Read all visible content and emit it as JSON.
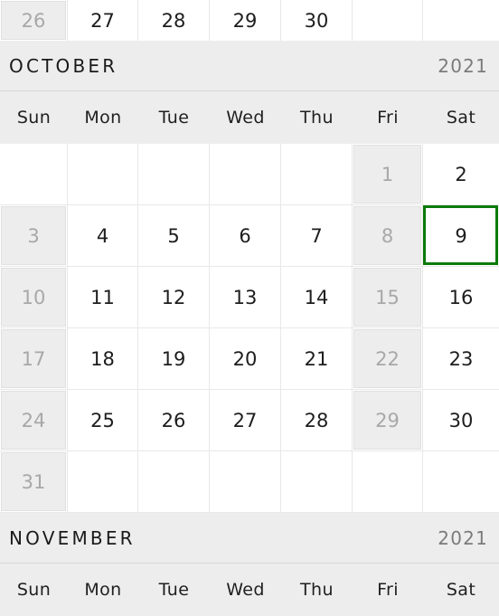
{
  "colors": {
    "selected_border": "#0a7a0a",
    "header_background": "#ededed",
    "disabled_text": "#a8a8a8",
    "day_text": "#1d1d1d",
    "year_text": "#7b7b7b",
    "grid_line": "#e8e8e8"
  },
  "weekday_labels": [
    "Sun",
    "Mon",
    "Tue",
    "Wed",
    "Thu",
    "Fri",
    "Sat"
  ],
  "prev_month_tail": {
    "days": [
      {
        "num": "26",
        "state": "disabled"
      },
      {
        "num": "27",
        "state": "normal"
      },
      {
        "num": "28",
        "state": "normal"
      },
      {
        "num": "29",
        "state": "normal"
      },
      {
        "num": "30",
        "state": "normal"
      },
      {
        "num": "",
        "state": "empty"
      },
      {
        "num": "",
        "state": "empty"
      }
    ]
  },
  "october": {
    "name": "OCTOBER",
    "year": "2021",
    "weeks": [
      [
        {
          "num": "",
          "state": "empty"
        },
        {
          "num": "",
          "state": "empty"
        },
        {
          "num": "",
          "state": "empty"
        },
        {
          "num": "",
          "state": "empty"
        },
        {
          "num": "",
          "state": "empty"
        },
        {
          "num": "1",
          "state": "disabled"
        },
        {
          "num": "2",
          "state": "normal"
        }
      ],
      [
        {
          "num": "3",
          "state": "disabled"
        },
        {
          "num": "4",
          "state": "normal"
        },
        {
          "num": "5",
          "state": "normal"
        },
        {
          "num": "6",
          "state": "normal"
        },
        {
          "num": "7",
          "state": "normal"
        },
        {
          "num": "8",
          "state": "disabled"
        },
        {
          "num": "9",
          "state": "selected"
        }
      ],
      [
        {
          "num": "10",
          "state": "disabled"
        },
        {
          "num": "11",
          "state": "normal"
        },
        {
          "num": "12",
          "state": "normal"
        },
        {
          "num": "13",
          "state": "normal"
        },
        {
          "num": "14",
          "state": "normal"
        },
        {
          "num": "15",
          "state": "disabled"
        },
        {
          "num": "16",
          "state": "normal"
        }
      ],
      [
        {
          "num": "17",
          "state": "disabled"
        },
        {
          "num": "18",
          "state": "normal"
        },
        {
          "num": "19",
          "state": "normal"
        },
        {
          "num": "20",
          "state": "normal"
        },
        {
          "num": "21",
          "state": "normal"
        },
        {
          "num": "22",
          "state": "disabled"
        },
        {
          "num": "23",
          "state": "normal"
        }
      ],
      [
        {
          "num": "24",
          "state": "disabled"
        },
        {
          "num": "25",
          "state": "normal"
        },
        {
          "num": "26",
          "state": "normal"
        },
        {
          "num": "27",
          "state": "normal"
        },
        {
          "num": "28",
          "state": "normal"
        },
        {
          "num": "29",
          "state": "disabled"
        },
        {
          "num": "30",
          "state": "normal"
        }
      ],
      [
        {
          "num": "31",
          "state": "disabled"
        },
        {
          "num": "",
          "state": "empty"
        },
        {
          "num": "",
          "state": "empty"
        },
        {
          "num": "",
          "state": "empty"
        },
        {
          "num": "",
          "state": "empty"
        },
        {
          "num": "",
          "state": "empty"
        },
        {
          "num": "",
          "state": "empty"
        }
      ]
    ]
  },
  "november": {
    "name": "NOVEMBER",
    "year": "2021"
  }
}
